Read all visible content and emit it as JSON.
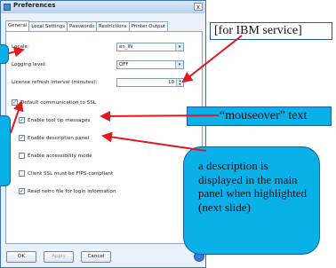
{
  "window": {
    "title": "Preferences",
    "close_glyph": "x"
  },
  "tabs": [
    "General",
    "Local Settings",
    "Passwords",
    "Restrictions",
    "Printer Output"
  ],
  "form": {
    "locale_label": "Locale:",
    "locale_value": "en_IN",
    "logging_label": "Logging level:",
    "logging_value": "OFF",
    "license_label": "License refresh interval (minutes):",
    "license_value": "10",
    "dropdown_glyph": "▾"
  },
  "checkboxes": [
    {
      "label": "Default communication to SSL",
      "checked": true
    },
    {
      "label": "Enable tool tip messages",
      "checked": true
    },
    {
      "label": "Enable description panel",
      "checked": true
    },
    {
      "label": "Enable accessibility mode",
      "checked": false
    },
    {
      "label": "Client SSL must be FIPS-compliant",
      "checked": false
    },
    {
      "label": "Read netrc file for login information",
      "checked": true
    }
  ],
  "check_glyph": "✓",
  "buttons": {
    "ok": "OK",
    "apply": "Apply",
    "cancel": "Cancel"
  },
  "callouts": {
    "ibm": "[for IBM service]",
    "mouseover": "“mouseover” text",
    "description": "a description is displayed in the main panel when highlighted (next slide)"
  },
  "colors": {
    "callout_fill": "#0ab0e8",
    "arrow": "#e0181f"
  }
}
